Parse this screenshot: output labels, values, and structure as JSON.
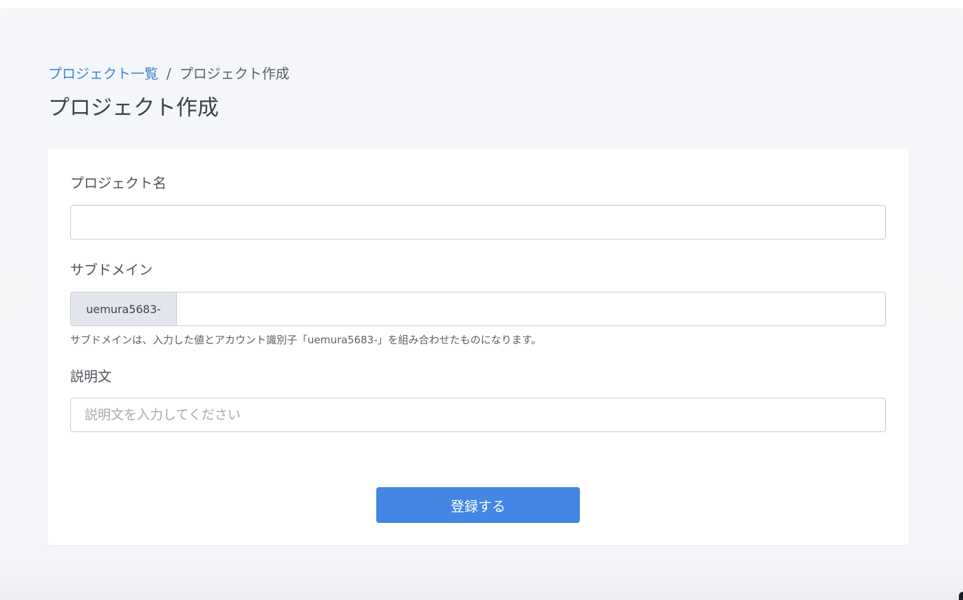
{
  "breadcrumb": {
    "parent_label": "プロジェクト一覧",
    "separator": "/",
    "current_label": "プロジェクト作成"
  },
  "page": {
    "title": "プロジェクト作成"
  },
  "form": {
    "project_name": {
      "label": "プロジェクト名",
      "value": "",
      "placeholder": ""
    },
    "subdomain": {
      "label": "サブドメイン",
      "prefix": "uemura5683-",
      "value": "",
      "help": "サブドメインは、入力した値とアカウント識別子「uemura5683-」を組み合わせたものになります。"
    },
    "description": {
      "label": "説明文",
      "value": "",
      "placeholder": "説明文を入力してください"
    },
    "submit_label": "登録する"
  },
  "colors": {
    "link": "#3d84dc",
    "primary_button": "#4386e4",
    "addon_background": "#e3e6ec",
    "page_background": "#f5f6f9"
  }
}
